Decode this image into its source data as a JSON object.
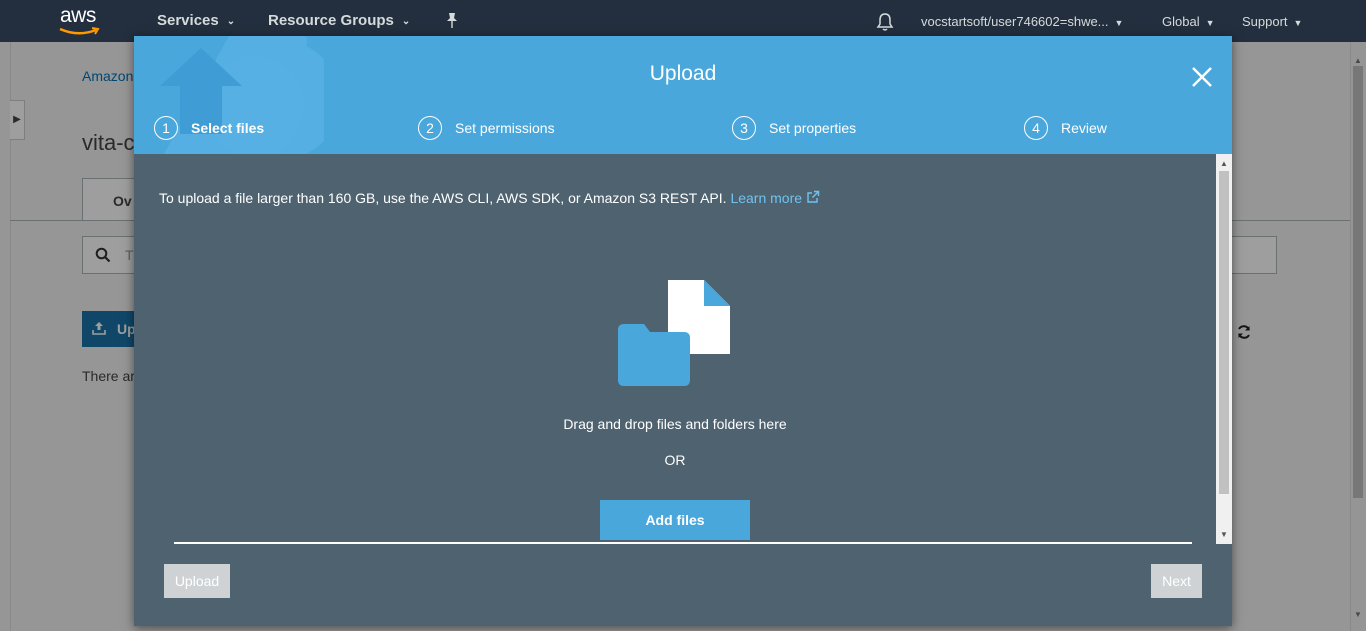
{
  "nav": {
    "logo_text": "aws",
    "services": "Services",
    "resource_groups": "Resource Groups",
    "account": "vocstartsoft/user746602=shwe...",
    "region": "Global",
    "support": "Support"
  },
  "background": {
    "breadcrumb": "Amazon",
    "title": "vita-c",
    "tab": "Ov",
    "search_placeholder": "T",
    "upload_button": "Up",
    "empty_text": "There ar"
  },
  "modal": {
    "title": "Upload",
    "steps": [
      {
        "num": "1",
        "label": "Select files"
      },
      {
        "num": "2",
        "label": "Set permissions"
      },
      {
        "num": "3",
        "label": "Set properties"
      },
      {
        "num": "4",
        "label": "Review"
      }
    ],
    "info_text": "To upload a file larger than 160 GB, use the AWS CLI, AWS SDK, or Amazon S3 REST API.",
    "learn_more": "Learn more",
    "drop_text": "Drag and drop files and folders here",
    "or_text": "OR",
    "add_files": "Add files",
    "upload_button": "Upload",
    "next_button": "Next"
  },
  "colors": {
    "nav_bg": "#232f3e",
    "modal_header": "#4aa7dc",
    "modal_body": "#4f6270",
    "link": "#6fc3f1",
    "button_disabled": "#cfd2d4"
  }
}
